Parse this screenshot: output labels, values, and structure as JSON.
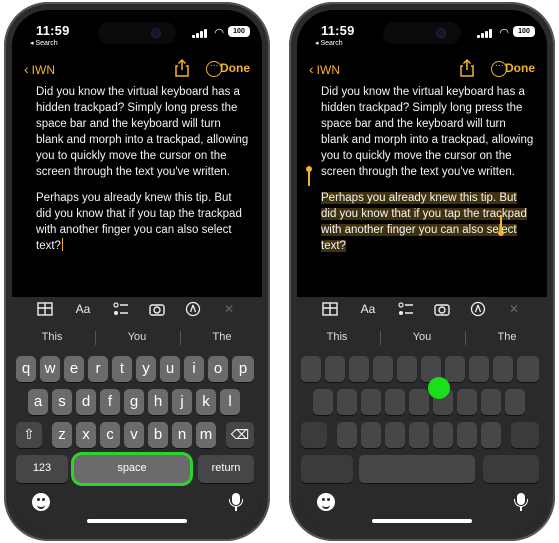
{
  "left_phone": {
    "status": {
      "time": "11:59",
      "back_app": "◂ Search",
      "battery": "100"
    },
    "nav": {
      "back_label": "IWN",
      "done_label": "Done"
    },
    "note": {
      "para1": "Did you know the virtual keyboard has a hidden trackpad? Simply long press the space bar and the keyboard will turn blank and morph into a trackpad, allowing you to quickly move the cursor on the screen through the text you've written.",
      "para2": "Perhaps you already knew this tip. But did you know that if you tap the trackpad with another finger you can also select text?"
    },
    "toolbar": {
      "format_label": "Aa"
    },
    "suggestions": [
      "This",
      "You",
      "The"
    ],
    "keyboard": {
      "row1": [
        "q",
        "w",
        "e",
        "r",
        "t",
        "y",
        "u",
        "i",
        "o",
        "p"
      ],
      "row2": [
        "a",
        "s",
        "d",
        "f",
        "g",
        "h",
        "j",
        "k",
        "l"
      ],
      "row3": [
        "z",
        "x",
        "c",
        "v",
        "b",
        "n",
        "m"
      ],
      "numbers_label": "123",
      "space_label": "space",
      "return_label": "return"
    }
  },
  "right_phone": {
    "status": {
      "time": "11:59",
      "back_app": "◂ Search",
      "battery": "100"
    },
    "nav": {
      "back_label": "IWN",
      "done_label": "Done"
    },
    "note": {
      "para1": "Did you know the virtual keyboard has a hidden trackpad? Simply long press the space bar and the keyboard will turn blank and morph into a trackpad, allowing you to quickly move the cursor on the screen through the text you've written.",
      "para2": "Perhaps you already knew this tip. But did you know that if you tap the trackpad with another finger you can also select text?"
    },
    "toolbar": {
      "format_label": "Aa"
    },
    "suggestions": [
      "This",
      "You",
      "The"
    ]
  },
  "colors": {
    "accent": "#f2b32c",
    "highlight_green": "#2cd52c",
    "selection": "#82641e"
  },
  "icons": [
    "signal-icon",
    "wifi-icon",
    "battery-icon",
    "chevron-left-icon",
    "share-icon",
    "more-icon",
    "table-icon",
    "checklist-icon",
    "camera-icon",
    "markup-icon",
    "close-icon",
    "shift-icon",
    "delete-icon",
    "emoji-icon",
    "mic-icon"
  ]
}
